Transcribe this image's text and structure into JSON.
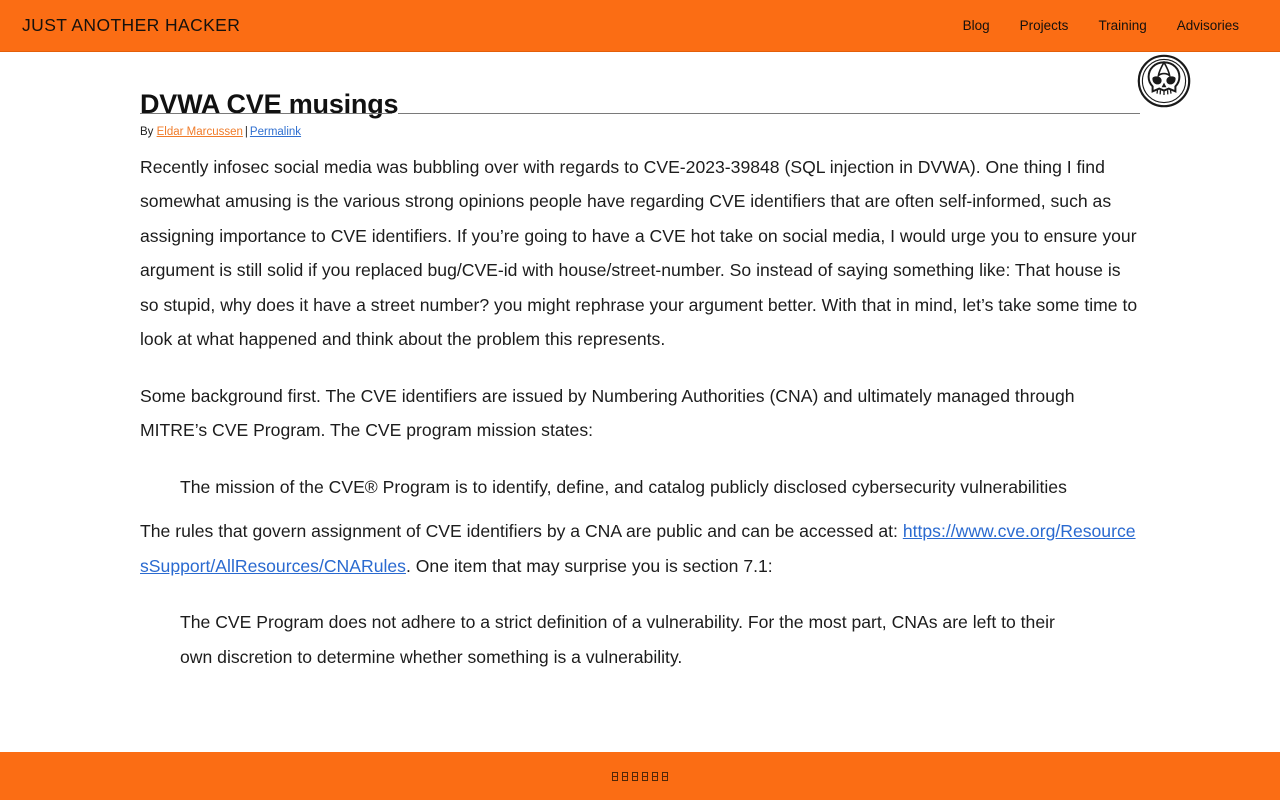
{
  "header": {
    "brand": "JUST ANOTHER HACKER",
    "nav": [
      {
        "label": "Blog"
      },
      {
        "label": "Projects"
      },
      {
        "label": "Training"
      },
      {
        "label": "Advisories"
      }
    ]
  },
  "article": {
    "title": "DVWA CVE musings",
    "byline": {
      "prefix": "By",
      "author": "Eldar Marcussen",
      "separator": "|",
      "permalink": "Permalink"
    },
    "logo_icon": "skull-logo-icon",
    "paragraphs": [
      {
        "id": "p1",
        "text": "Recently infosec social media was bubbling over with regards to CVE-2023-39848 (SQL injection in DVWA). One thing I find somewhat amusing is the various strong opinions people have regarding CVE identifiers that are often self-informed, such as assigning importance to CVE identifiers. If you’re going to have a CVE hot take on social media, I would urge you to ensure your argument is still solid if you replaced bug/CVE-id with house/street-number. So instead of saying something like: That house is so stupid, why does it have a street number? you might rephrase your argument better. With that in mind, let’s take some time to look at what happened and think about the problem this represents."
      },
      {
        "id": "p2",
        "text": "Some background first. The CVE identifiers are issued by Numbering Authorities (CNA) and ultimately managed through MITRE’s CVE Program. The CVE program mission states:"
      }
    ],
    "quote1": "The mission of the CVE® Program is to identify, define, and catalog publicly disclosed cybersecurity vulnerabilities",
    "rules_paragraph": {
      "lead": "The rules that govern assignment of CVE identifiers by a CNA are public and can be accessed at: ",
      "link_text": "https://www.cve.org/ResourcesSupport/AllResources/CNARules",
      "tail": ". One item that may surprise you is section 7.1:"
    },
    "quote2": "The CVE Program does not adhere to a strict definition of a vulnerability. For the most part, CNAs are left to their own discretion to determine whether something is a vulnerability."
  },
  "footer": {
    "social_icons": [
      "missing-glyph-icon",
      "missing-glyph-icon",
      "missing-glyph-icon",
      "missing-glyph-icon",
      "missing-glyph-icon",
      "missing-glyph-icon"
    ]
  },
  "colors": {
    "brand_orange": "#fb6d14",
    "link_blue": "#2a6ad0",
    "author_orange": "#f07c2a",
    "text": "#1c1c1c"
  }
}
